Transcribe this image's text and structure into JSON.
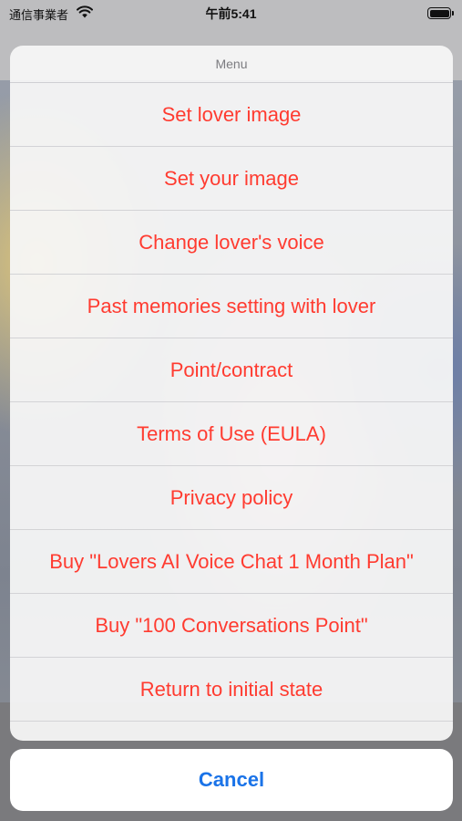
{
  "status_bar": {
    "carrier": "通信事業者",
    "time": "午前5:41"
  },
  "sheet": {
    "title": "Menu",
    "items": [
      {
        "label": "Set lover image"
      },
      {
        "label": "Set your image"
      },
      {
        "label": "Change lover's voice"
      },
      {
        "label": "Past memories setting with lover"
      },
      {
        "label": "Point/contract"
      },
      {
        "label": "Terms of Use (EULA)"
      },
      {
        "label": "Privacy policy"
      },
      {
        "label": "Buy \"Lovers AI Voice Chat 1 Month Plan\""
      },
      {
        "label": "Buy \"100 Conversations Point\""
      },
      {
        "label": "Return to initial state"
      }
    ],
    "cancel_label": "Cancel"
  },
  "colors": {
    "destructive": "#ff3b30",
    "cancel": "#1a73e8"
  }
}
